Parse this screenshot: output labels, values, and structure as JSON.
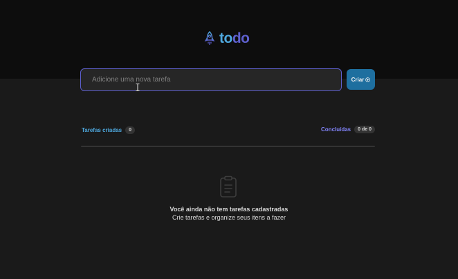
{
  "app": {
    "logo_part1": "to",
    "logo_part2": "do",
    "logo_icon": "rocket-icon"
  },
  "new_task": {
    "placeholder": "Adicione uma nova tarefa",
    "value": ""
  },
  "create_button": {
    "label": "Criar",
    "icon": "plus-circle-icon"
  },
  "counters": {
    "created_label": "Tarefas criadas",
    "created_count": "0",
    "done_label": "Concluídas",
    "done_count": "0 de 0"
  },
  "empty_state": {
    "icon": "clipboard-icon",
    "title": "Você ainda não tem tarefas cadastradas",
    "subtitle": "Crie tarefas e organize seus itens a fazer"
  },
  "colors": {
    "header_bg": "#0d0d0d",
    "body_bg": "#1a1a1a",
    "blue": "#4ea8de",
    "purple": "#5e60ce",
    "purple_light": "#8284fa",
    "button_bg": "#1e6f9f"
  }
}
